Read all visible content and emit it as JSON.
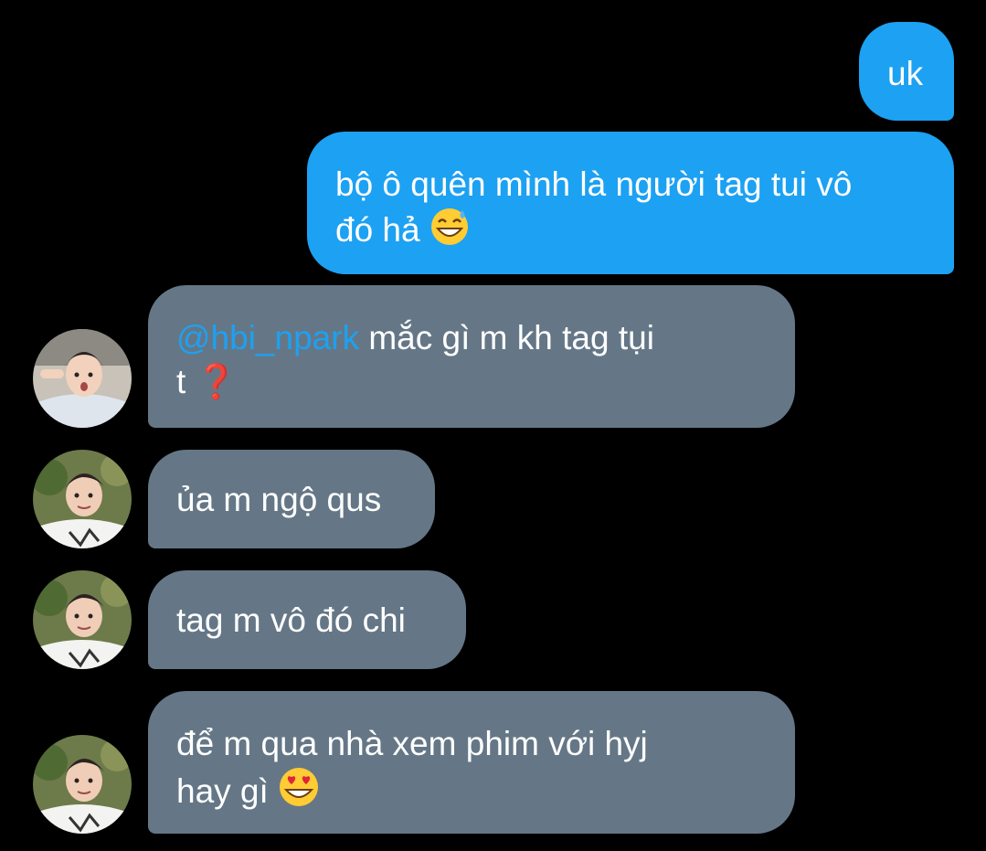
{
  "colors": {
    "background": "#000000",
    "outgoing_bubble": "#1da1f2",
    "incoming_bubble": "#657786",
    "mention": "#1da1f2",
    "text": "#ffffff"
  },
  "messages": [
    {
      "direction": "outgoing",
      "line1": "uk"
    },
    {
      "direction": "outgoing",
      "line1": "bộ ô quên mình là người tag tui vô",
      "line2": "đó hả",
      "emoji": "grinning-face-with-sweat-emoji"
    },
    {
      "direction": "incoming",
      "avatar": "avatar-photo-1",
      "mention": "@hbi_npark",
      "line1": " mắc gì m kh tag tụi",
      "line2": "t",
      "emoji": "red-question-mark-emoji",
      "emoji_char": "❓"
    },
    {
      "direction": "incoming",
      "avatar": "avatar-photo-2",
      "line1": "ủa m ngộ qus"
    },
    {
      "direction": "incoming",
      "avatar": "avatar-photo-2",
      "line1": "tag m vô đó chi"
    },
    {
      "direction": "incoming",
      "avatar": "avatar-photo-2",
      "line1": "để m qua nhà xem phim với hyj",
      "line2": "hay gì",
      "emoji": "smiling-face-with-heart-eyes-emoji"
    }
  ]
}
